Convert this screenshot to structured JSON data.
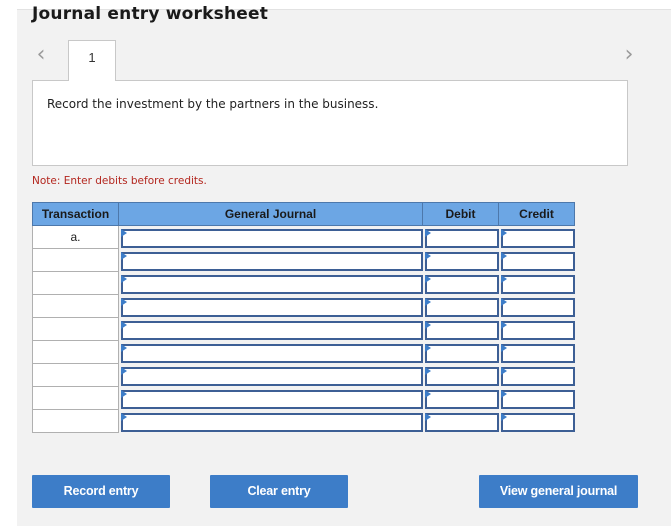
{
  "header": {
    "title": "Journal entry worksheet"
  },
  "nav": {
    "prev_icon": "chevron-left-icon",
    "next_icon": "chevron-right-icon",
    "tab_label": "1"
  },
  "instruction": {
    "text": "Record the investment by the partners in the business."
  },
  "note": {
    "text": "Note: Enter debits before credits."
  },
  "journal": {
    "columns": [
      "Transaction",
      "General Journal",
      "Debit",
      "Credit"
    ],
    "rows": [
      {
        "transaction": "a.",
        "account": "",
        "debit": "",
        "credit": ""
      },
      {
        "transaction": "",
        "account": "",
        "debit": "",
        "credit": ""
      },
      {
        "transaction": "",
        "account": "",
        "debit": "",
        "credit": ""
      },
      {
        "transaction": "",
        "account": "",
        "debit": "",
        "credit": ""
      },
      {
        "transaction": "",
        "account": "",
        "debit": "",
        "credit": ""
      },
      {
        "transaction": "",
        "account": "",
        "debit": "",
        "credit": ""
      },
      {
        "transaction": "",
        "account": "",
        "debit": "",
        "credit": ""
      },
      {
        "transaction": "",
        "account": "",
        "debit": "",
        "credit": ""
      },
      {
        "transaction": "",
        "account": "",
        "debit": "",
        "credit": ""
      }
    ]
  },
  "buttons": {
    "record": "Record entry",
    "clear": "Clear entry",
    "view": "View general journal"
  },
  "colors": {
    "accent": "#3d7dc8",
    "header_bg": "#6ca6e4",
    "note": "#b3261e",
    "panel": "#f2f2f2"
  }
}
